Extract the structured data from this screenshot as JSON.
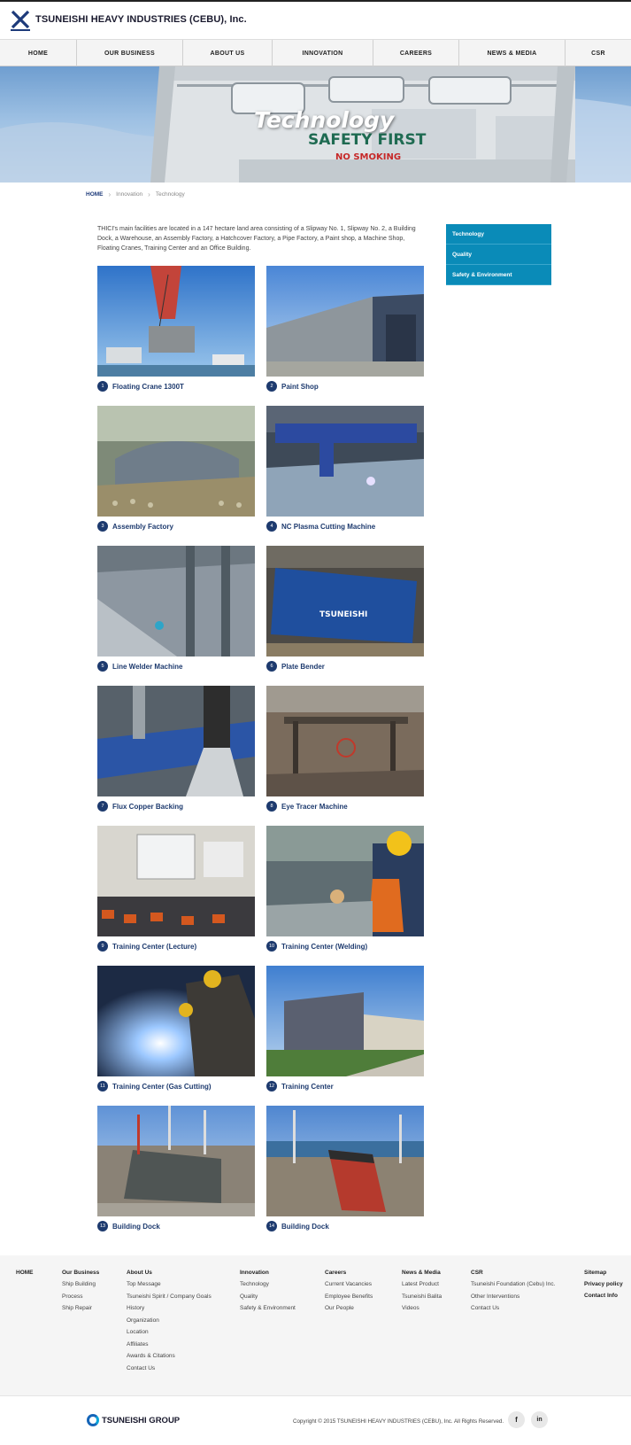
{
  "header": {
    "site_title": "TSUNEISHI HEAVY INDUSTRIES (CEBU), Inc.",
    "logo_icon": "tsuneishi-logo-icon"
  },
  "nav": {
    "items": [
      {
        "label": "HOME"
      },
      {
        "label": "OUR BUSINESS"
      },
      {
        "label": "ABOUT US"
      },
      {
        "label": "INNOVATION"
      },
      {
        "label": "CAREERS"
      },
      {
        "label": "NEWS & MEDIA"
      },
      {
        "label": "CSR"
      }
    ]
  },
  "hero": {
    "title": "Technology",
    "sign_line1": "SAFETY FIRST",
    "sign_line2": "NO SMOKING"
  },
  "breadcrumb": {
    "home": "HOME",
    "level1": "Innovation",
    "level2": "Technology"
  },
  "intro": {
    "text": "THICI's main facilities are located in a 147 hectare land area consisting of a Slipway No. 1, Slipway No. 2, a Building Dock, a Warehouse, an Assembly Factory, a Hatchcover Factory, a Pipe Factory, a Paint shop, a Machine Shop, Floating Cranes, Training Center and an Office Building."
  },
  "side_nav": {
    "items": [
      {
        "label": "Technology"
      },
      {
        "label": "Quality"
      },
      {
        "label": "Safety & Environment"
      }
    ]
  },
  "facilities": [
    {
      "num": "1",
      "caption": "Floating Crane 1300T"
    },
    {
      "num": "2",
      "caption": "Paint Shop"
    },
    {
      "num": "3",
      "caption": "Assembly Factory"
    },
    {
      "num": "4",
      "caption": "NC Plasma Cutting Machine"
    },
    {
      "num": "5",
      "caption": "Line Welder Machine"
    },
    {
      "num": "6",
      "caption": "Plate Bender"
    },
    {
      "num": "7",
      "caption": "Flux Copper Backing"
    },
    {
      "num": "8",
      "caption": "Eye Tracer Machine"
    },
    {
      "num": "9",
      "caption": "Training Center (Lecture)"
    },
    {
      "num": "10",
      "caption": "Training Center (Welding)"
    },
    {
      "num": "11",
      "caption": "Training Center (Gas Cutting)"
    },
    {
      "num": "12",
      "caption": "Training Center"
    },
    {
      "num": "13",
      "caption": "Building Dock"
    },
    {
      "num": "14",
      "caption": "Building Dock"
    }
  ],
  "footer": {
    "home": "HOME",
    "our_business": {
      "head": "Our Business",
      "links": [
        "Ship Building",
        "Process",
        "Ship Repair"
      ]
    },
    "about_us": {
      "head": "About Us",
      "links": [
        "Top Message",
        "Tsuneishi Spirit / Company Goals",
        "History",
        "Organization",
        "Location",
        "Affiliates",
        "Awards & Citations",
        "Contact Us"
      ]
    },
    "innovation": {
      "head": "Innovation",
      "links": [
        "Technology",
        "Quality",
        "Safety & Environment"
      ]
    },
    "careers": {
      "head": "Careers",
      "links": [
        "Current Vacancies",
        "Employee Benefits",
        "Our People"
      ]
    },
    "news_media": {
      "head": "News & Media",
      "links": [
        "Latest Product",
        "Tsuneishi Balita",
        "Videos"
      ]
    },
    "csr": {
      "head": "CSR",
      "links": [
        "Tsuneishi Foundation (Cebu) Inc.",
        "Other Interventions",
        "Contact Us"
      ]
    },
    "misc": {
      "sitemap": "Sitemap",
      "privacy": "Privacy policy",
      "contact": "Contact Info"
    }
  },
  "bottom": {
    "group_name": "TSUNEISHI GROUP",
    "copyright": "Copyright © 2015 TSUNEISHI HEAVY INDUSTRIES (CEBU), Inc. All Rights Reserved.",
    "facebook": "f",
    "linkedin": "in"
  }
}
